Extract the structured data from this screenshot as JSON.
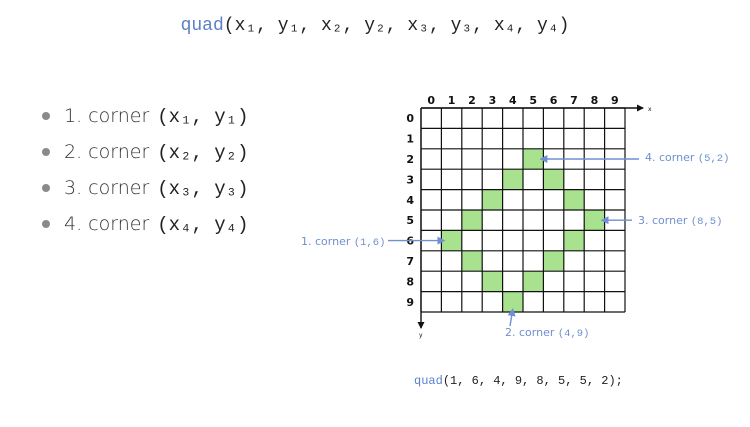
{
  "title": {
    "fn": "quad",
    "args": "(x₁, y₁, x₂, y₂, x₃, y₃, x₄, y₄)"
  },
  "corners_list": [
    {
      "label": "1. corner",
      "coords": "(x₁, y₁)"
    },
    {
      "label": "2. corner",
      "coords": "(x₂, y₂)"
    },
    {
      "label": "3. corner",
      "coords": "(x₃, y₃)"
    },
    {
      "label": "4. corner",
      "coords": "(x₄, y₄)"
    }
  ],
  "grid": {
    "x_ticks": [
      "0",
      "1",
      "2",
      "3",
      "4",
      "5",
      "6",
      "7",
      "8",
      "9"
    ],
    "y_ticks": [
      "0",
      "1",
      "2",
      "3",
      "4",
      "5",
      "6",
      "7",
      "8",
      "9"
    ],
    "x_axis_label": "x",
    "y_axis_label": "y",
    "filled_cells": [
      [
        5,
        2
      ],
      [
        4,
        3
      ],
      [
        6,
        3
      ],
      [
        3,
        4
      ],
      [
        7,
        4
      ],
      [
        2,
        5
      ],
      [
        8,
        5
      ],
      [
        1,
        6
      ],
      [
        7,
        6
      ],
      [
        2,
        7
      ],
      [
        6,
        7
      ],
      [
        3,
        8
      ],
      [
        5,
        8
      ],
      [
        4,
        9
      ]
    ],
    "fill_color": "#a8e28f",
    "line_color": "#111111"
  },
  "callouts": [
    {
      "prefix": "1. corner",
      "coords": "(1,6)",
      "cell": [
        1,
        6
      ]
    },
    {
      "prefix": "2. corner",
      "coords": "(4,9)",
      "cell": [
        4,
        9
      ]
    },
    {
      "prefix": "3. corner",
      "coords": "(8,5)",
      "cell": [
        8,
        5
      ]
    },
    {
      "prefix": "4. corner",
      "coords": "(5,2)",
      "cell": [
        5,
        2
      ]
    }
  ],
  "accent_color": "#6f8fd0",
  "code": {
    "fn": "quad",
    "args": "(1, 6, 4, 9, 8, 5, 5, 2);"
  }
}
